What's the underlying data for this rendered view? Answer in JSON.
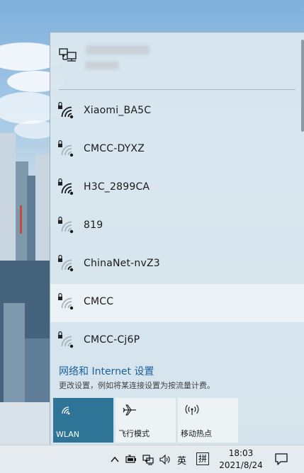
{
  "flyout": {
    "current_connection": {
      "icon": "wired-network-icon"
    },
    "networks": [
      {
        "ssid": "Xiaomi_BA5C",
        "icon": "wifi-secured-icon",
        "bars": 4
      },
      {
        "ssid": "CMCC-DYXZ",
        "icon": "wifi-secured-icon",
        "bars": 1
      },
      {
        "ssid": "H3C_2899CA",
        "icon": "wifi-secured-icon",
        "bars": 4
      },
      {
        "ssid": "819",
        "icon": "wifi-secured-icon",
        "bars": 1
      },
      {
        "ssid": "ChinaNet-nvZ3",
        "icon": "wifi-secured-icon",
        "bars": 2
      },
      {
        "ssid": "CMCC",
        "icon": "wifi-secured-icon",
        "bars": 1,
        "highlighted": true
      },
      {
        "ssid": "CMCC-Cj6P",
        "icon": "wifi-secured-icon",
        "bars": 1
      }
    ],
    "settings_link": "网络和 Internet 设置",
    "settings_desc": "更改设置，例如将某连接设置为按流量计费。",
    "quick_actions": [
      {
        "label": "WLAN",
        "icon": "wifi-icon",
        "active": true
      },
      {
        "label": "飞行模式",
        "icon": "airplane-icon",
        "active": false
      },
      {
        "label": "移动热点",
        "icon": "hotspot-icon",
        "active": false
      }
    ],
    "colors": {
      "accent": "#2d7497",
      "link": "#1a5f9a"
    }
  },
  "taskbar": {
    "tray_icons": [
      "chevron-up-icon",
      "battery-icon",
      "network-icon",
      "volume-icon"
    ],
    "input_lang": "英",
    "ime_mode": "拼",
    "time": "18:03",
    "date": "2021/8/24",
    "notification_icon": "action-center-icon"
  }
}
